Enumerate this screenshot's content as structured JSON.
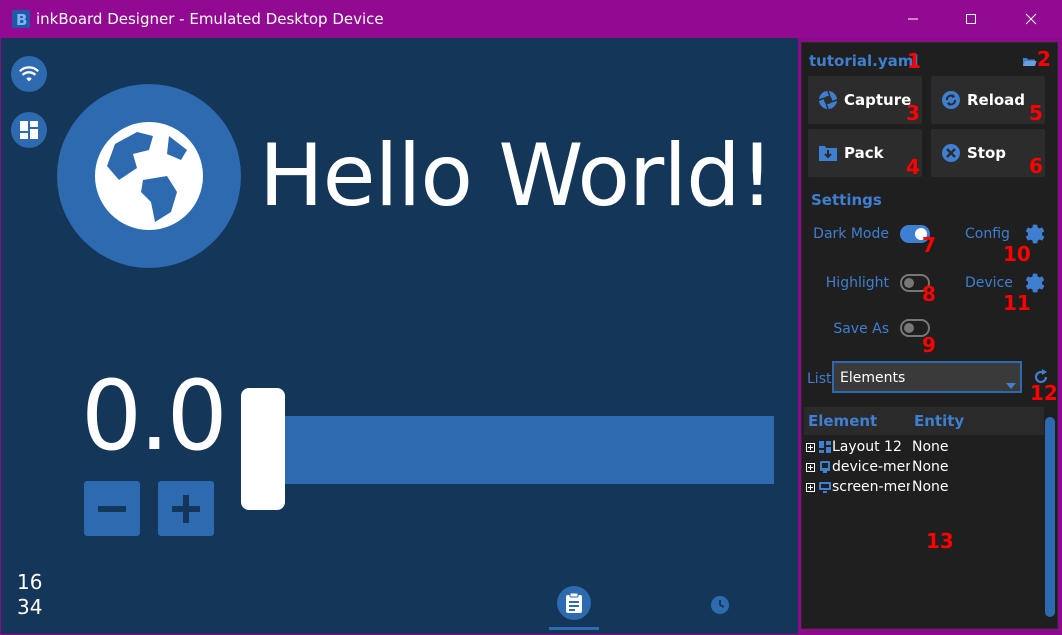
{
  "window": {
    "title": "inkBoard Designer - Emulated Desktop Device",
    "controls": {
      "minimize": "minimize-icon",
      "maximize": "maximize-icon",
      "close": "close-icon"
    }
  },
  "device_screen": {
    "side_icons": [
      "wifi-icon",
      "dashboard-icon"
    ],
    "greeting": "Hello World!",
    "greeting_icon": "earth-icon",
    "slider": {
      "value_text": "0.0",
      "value": 0.0
    },
    "clock": {
      "hours": "16",
      "minutes": "34"
    },
    "bottom_tabs": [
      {
        "icon": "clipboard-icon",
        "active": true
      },
      {
        "icon": "clock-icon",
        "active": false
      }
    ]
  },
  "panel": {
    "file_name": "tutorial.yaml",
    "buttons": {
      "capture": "Capture",
      "reload": "Reload",
      "pack": "Pack",
      "stop": "Stop"
    },
    "settings": {
      "header": "Settings",
      "dark_mode": {
        "label": "Dark Mode",
        "on": true
      },
      "highlight": {
        "label": "Highlight",
        "on": false
      },
      "save_as": {
        "label": "Save As",
        "on": false
      },
      "config_label": "Config",
      "device_label": "Device"
    },
    "list": {
      "label": "List",
      "selected": "Elements"
    },
    "tree": {
      "columns": [
        "Element",
        "Entity"
      ],
      "rows": [
        {
          "element": "Layout 12",
          "entity": "None",
          "icon": "layout-icon"
        },
        {
          "element": "device-menu",
          "entity": "None",
          "icon": "device-icon"
        },
        {
          "element": "screen-menu",
          "entity": "None",
          "icon": "screen-icon"
        }
      ]
    },
    "annotations": [
      "1",
      "2",
      "3",
      "4",
      "5",
      "6",
      "7",
      "8",
      "9",
      "10",
      "11",
      "12",
      "13"
    ]
  },
  "colors": {
    "titlebar": "#920a92",
    "screen_bg": "#143659",
    "accent": "#2e6ab0",
    "panel_bg": "#1f1f1f",
    "annotation": "#ff0000"
  }
}
